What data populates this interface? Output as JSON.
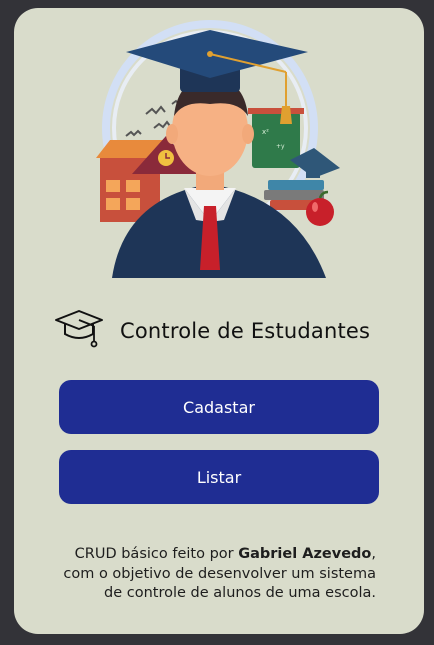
{
  "app": {
    "title": "Controle de Estudantes"
  },
  "icons": {
    "hero": "graduate-student-illustration",
    "title": "graduation-cap-icon"
  },
  "buttons": {
    "cadastrar_label": "Cadastar",
    "listar_label": "Listar"
  },
  "footer": {
    "line1_prefix": "CRUD básico feito por ",
    "author": "Gabriel Azevedo",
    "line1_suffix": ",",
    "line2": "com o objetivo de desenvolver um sistema",
    "line3": "de controle de alunos de uma escola."
  },
  "colors": {
    "background": "#333338",
    "card": "#d9dccb",
    "button": "#1f2d93",
    "button_text": "#ffffff"
  }
}
